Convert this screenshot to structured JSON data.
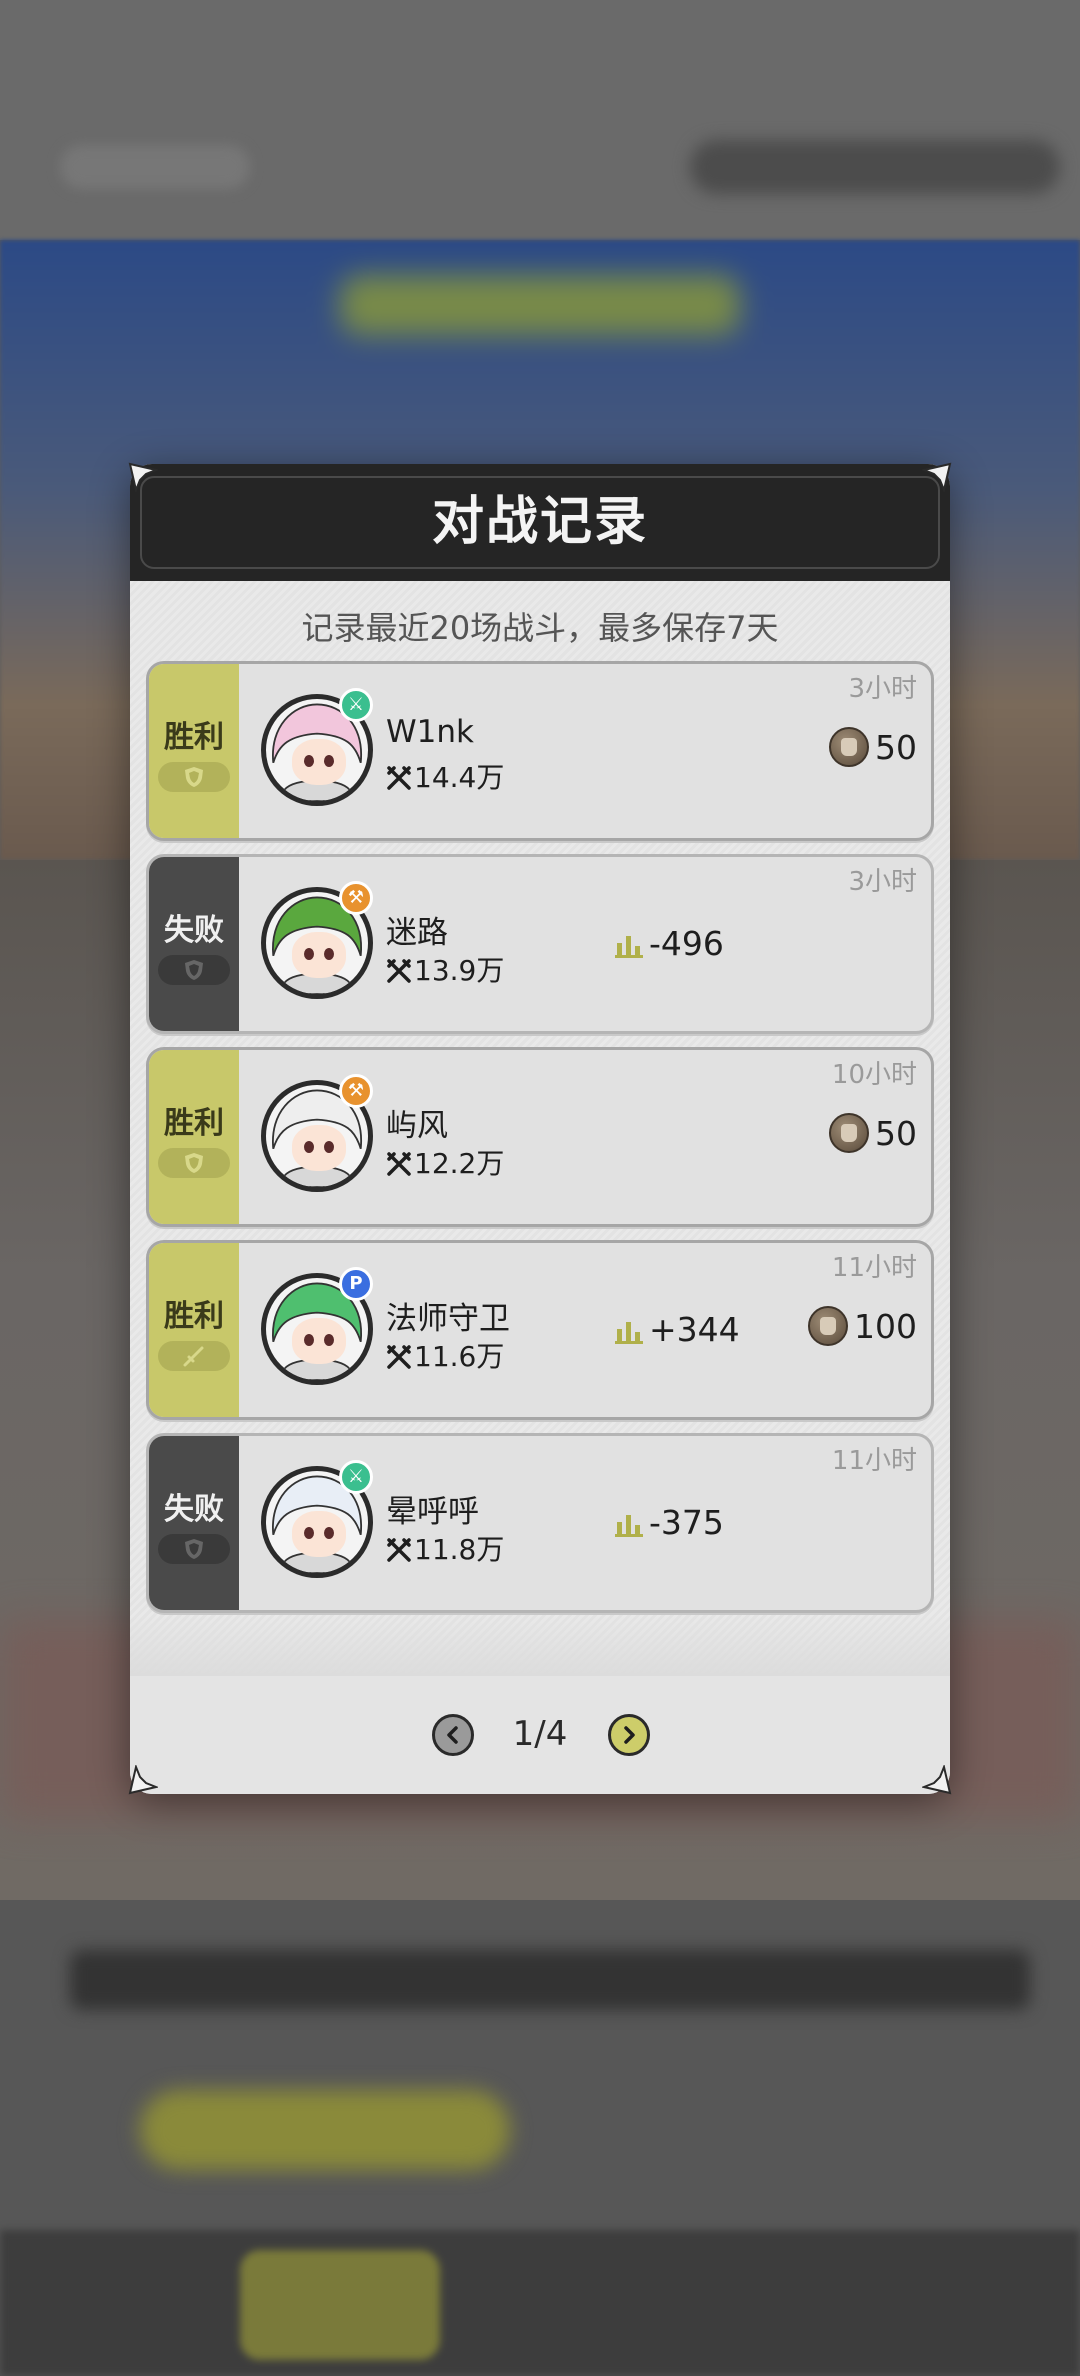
{
  "dialog": {
    "title": "对战记录",
    "subtitle": "记录最近20场战斗，最多保存7天"
  },
  "records": [
    {
      "result": "胜利",
      "outcome": "win",
      "time": "3小时",
      "name": "W1nk",
      "power": "14.4万",
      "rank_change": "",
      "coins": "50",
      "class_icon": "swordsman-class-icon",
      "class_color": "#3bbf8f",
      "hair_color": "#f2c6dc",
      "mark_icon": "shield-icon"
    },
    {
      "result": "失败",
      "outcome": "lose",
      "time": "3小时",
      "name": "迷路",
      "power": "13.9万",
      "rank_change": "-496",
      "coins": "",
      "class_icon": "warrior-class-icon",
      "class_color": "#e8922e",
      "hair_color": "#5aa83e",
      "mark_icon": "shield-icon"
    },
    {
      "result": "胜利",
      "outcome": "win",
      "time": "10小时",
      "name": "屿风",
      "power": "12.2万",
      "rank_change": "",
      "coins": "50",
      "class_icon": "warrior-class-icon",
      "class_color": "#e8922e",
      "hair_color": "#eeeeee",
      "mark_icon": "shield-icon"
    },
    {
      "result": "胜利",
      "outcome": "win",
      "time": "11小时",
      "name": "法师守卫",
      "power": "11.6万",
      "rank_change": "+344",
      "coins": "100",
      "class_icon": "mage-class-icon",
      "class_color": "#3a6ee0",
      "hair_color": "#4fbf6f",
      "mark_icon": "sword-icon"
    },
    {
      "result": "失败",
      "outcome": "lose",
      "time": "11小时",
      "name": "晕呼呼",
      "power": "11.8万",
      "rank_change": "-375",
      "coins": "",
      "class_icon": "swordsman-class-icon",
      "class_color": "#3bbf8f",
      "hair_color": "#e8eef6",
      "mark_icon": "shield-icon"
    }
  ],
  "pagination": {
    "current": "1/4"
  },
  "colors": {
    "win": "#c8c86a",
    "lose": "#4a4a4a",
    "accent": "#cdcd6a"
  }
}
